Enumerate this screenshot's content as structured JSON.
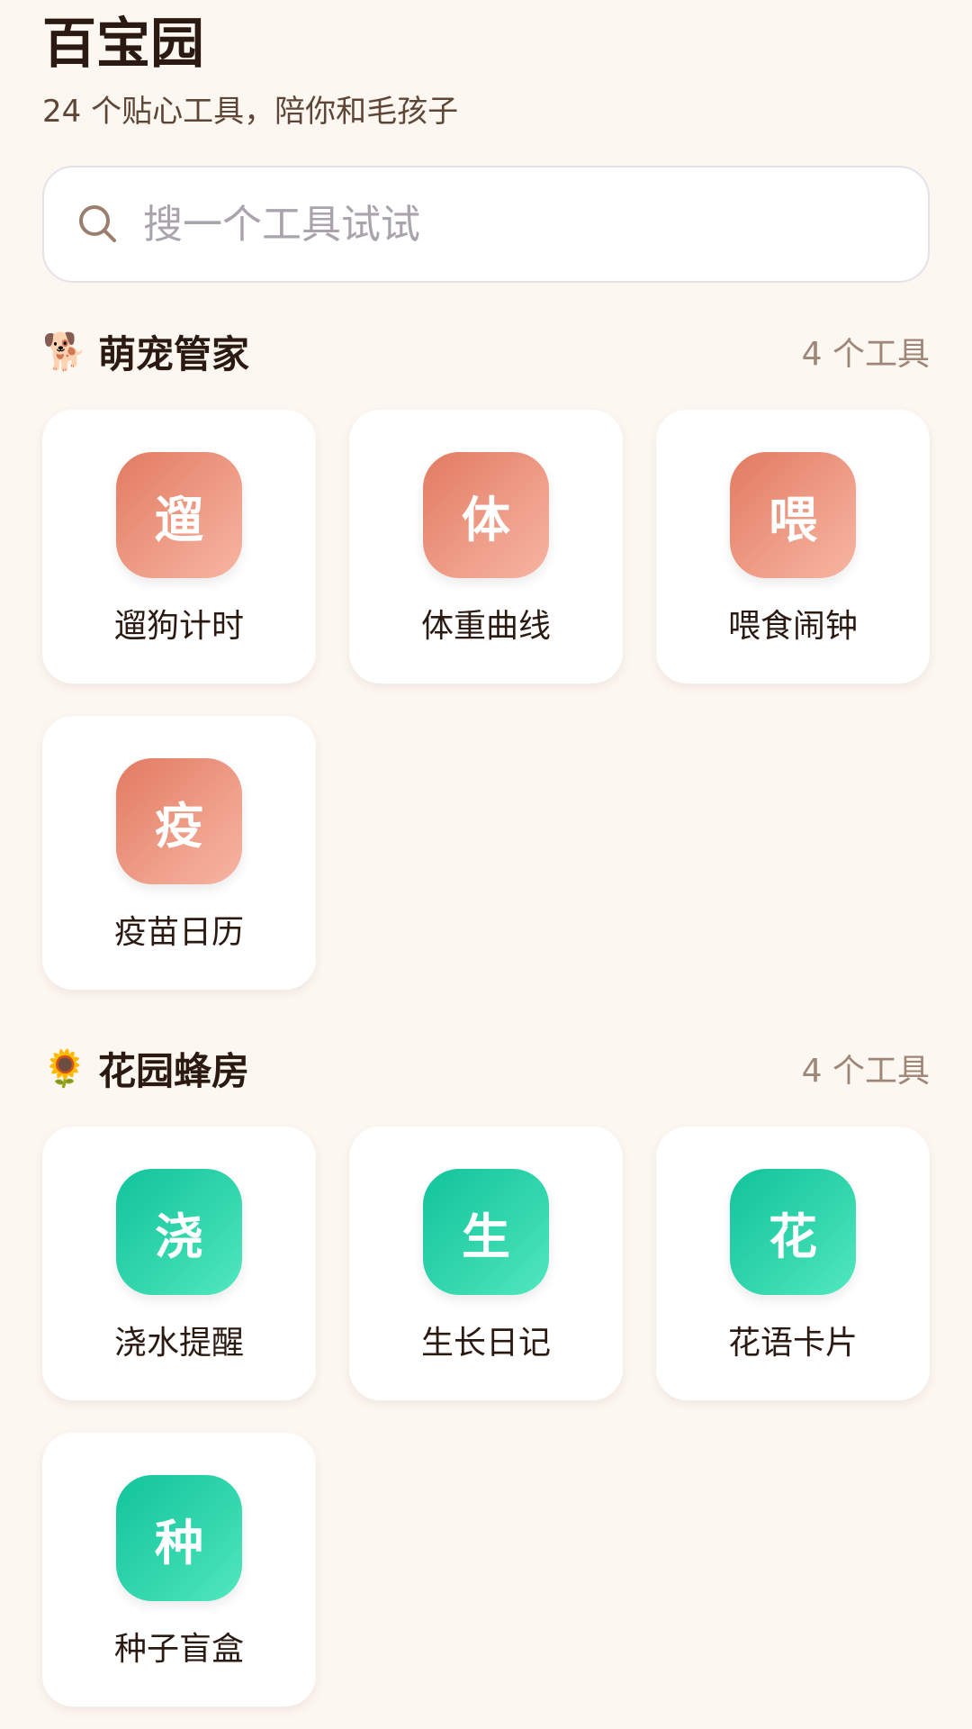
{
  "header": {
    "title": "百宝园",
    "subtitle": "24 个贴心工具，陪你和毛孩子"
  },
  "search": {
    "placeholder": "搜一个工具试试",
    "value": ""
  },
  "sections": [
    {
      "emoji": "🐕",
      "title": "萌宠管家",
      "count": "4 个工具",
      "theme": "#E88A72",
      "tools": [
        {
          "icon_char": "遛",
          "label": "遛狗计时"
        },
        {
          "icon_char": "体",
          "label": "体重曲线"
        },
        {
          "icon_char": "喂",
          "label": "喂食闹钟"
        },
        {
          "icon_char": "疫",
          "label": "疫苗日历"
        }
      ]
    },
    {
      "emoji": "🌻",
      "title": "花园蜂房",
      "count": "4 个工具",
      "theme": "#2FCFA6",
      "tools": [
        {
          "icon_char": "浇",
          "label": "浇水提醒"
        },
        {
          "icon_char": "生",
          "label": "生长日记"
        },
        {
          "icon_char": "花",
          "label": "花语卡片"
        },
        {
          "icon_char": "种",
          "label": "种子盲盒"
        }
      ]
    }
  ]
}
